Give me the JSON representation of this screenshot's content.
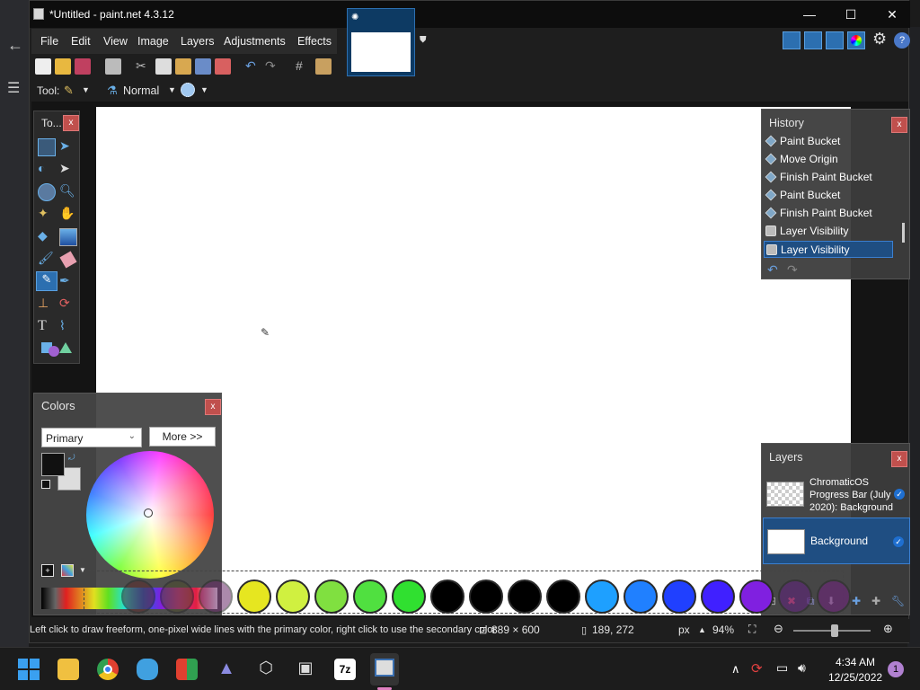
{
  "window": {
    "title": "*Untitled - paint.net 4.3.12",
    "min": "—",
    "max": "☐",
    "close": "✕"
  },
  "menu": [
    "File",
    "Edit",
    "View",
    "Image",
    "Layers",
    "Adjustments",
    "Effects"
  ],
  "toolbar2": {
    "tool_label": "Tool:",
    "blend_mode": "Normal"
  },
  "tools_panel": {
    "title": "To...",
    "close": "x"
  },
  "colors_panel": {
    "title": "Colors",
    "close": "x",
    "mode": "Primary",
    "more_label": "More >>"
  },
  "history_panel": {
    "title": "History",
    "close": "x",
    "items": [
      "Paint Bucket",
      "Move Origin",
      "Finish Paint Bucket",
      "Paint Bucket",
      "Finish Paint Bucket",
      "Layer Visibility",
      "Layer Visibility"
    ]
  },
  "layers_panel": {
    "title": "Layers",
    "close": "x",
    "layers": [
      {
        "name": "ChromaticOS Progress Bar (July 2020): Background",
        "visible": true
      },
      {
        "name": "Background",
        "visible": true
      }
    ]
  },
  "palette_colors": [
    "#5a2a2a",
    "#4a4a2a",
    "#6a2a6a",
    "#e6e620",
    "#d0f040",
    "#80e040",
    "#50e040",
    "#30e030",
    "#000000",
    "#000000",
    "#000000",
    "#000000",
    "#1ea0ff",
    "#2080ff",
    "#2040ff",
    "#4020ff",
    "#8020e0",
    "#602080",
    "#702080"
  ],
  "status": {
    "hint": "Left click to draw freeform, one-pixel wide lines with the primary color, right click to use the secondary color",
    "image_size": "889 × 600",
    "cursor_pos": "189, 272",
    "units": "px",
    "zoom": "94%"
  },
  "taskbar": {
    "time": "4:34 AM",
    "date": "12/25/2022",
    "notif_count": "1"
  },
  "colors": {
    "accent": "#1f4e82",
    "close_red": "#c0504d"
  }
}
